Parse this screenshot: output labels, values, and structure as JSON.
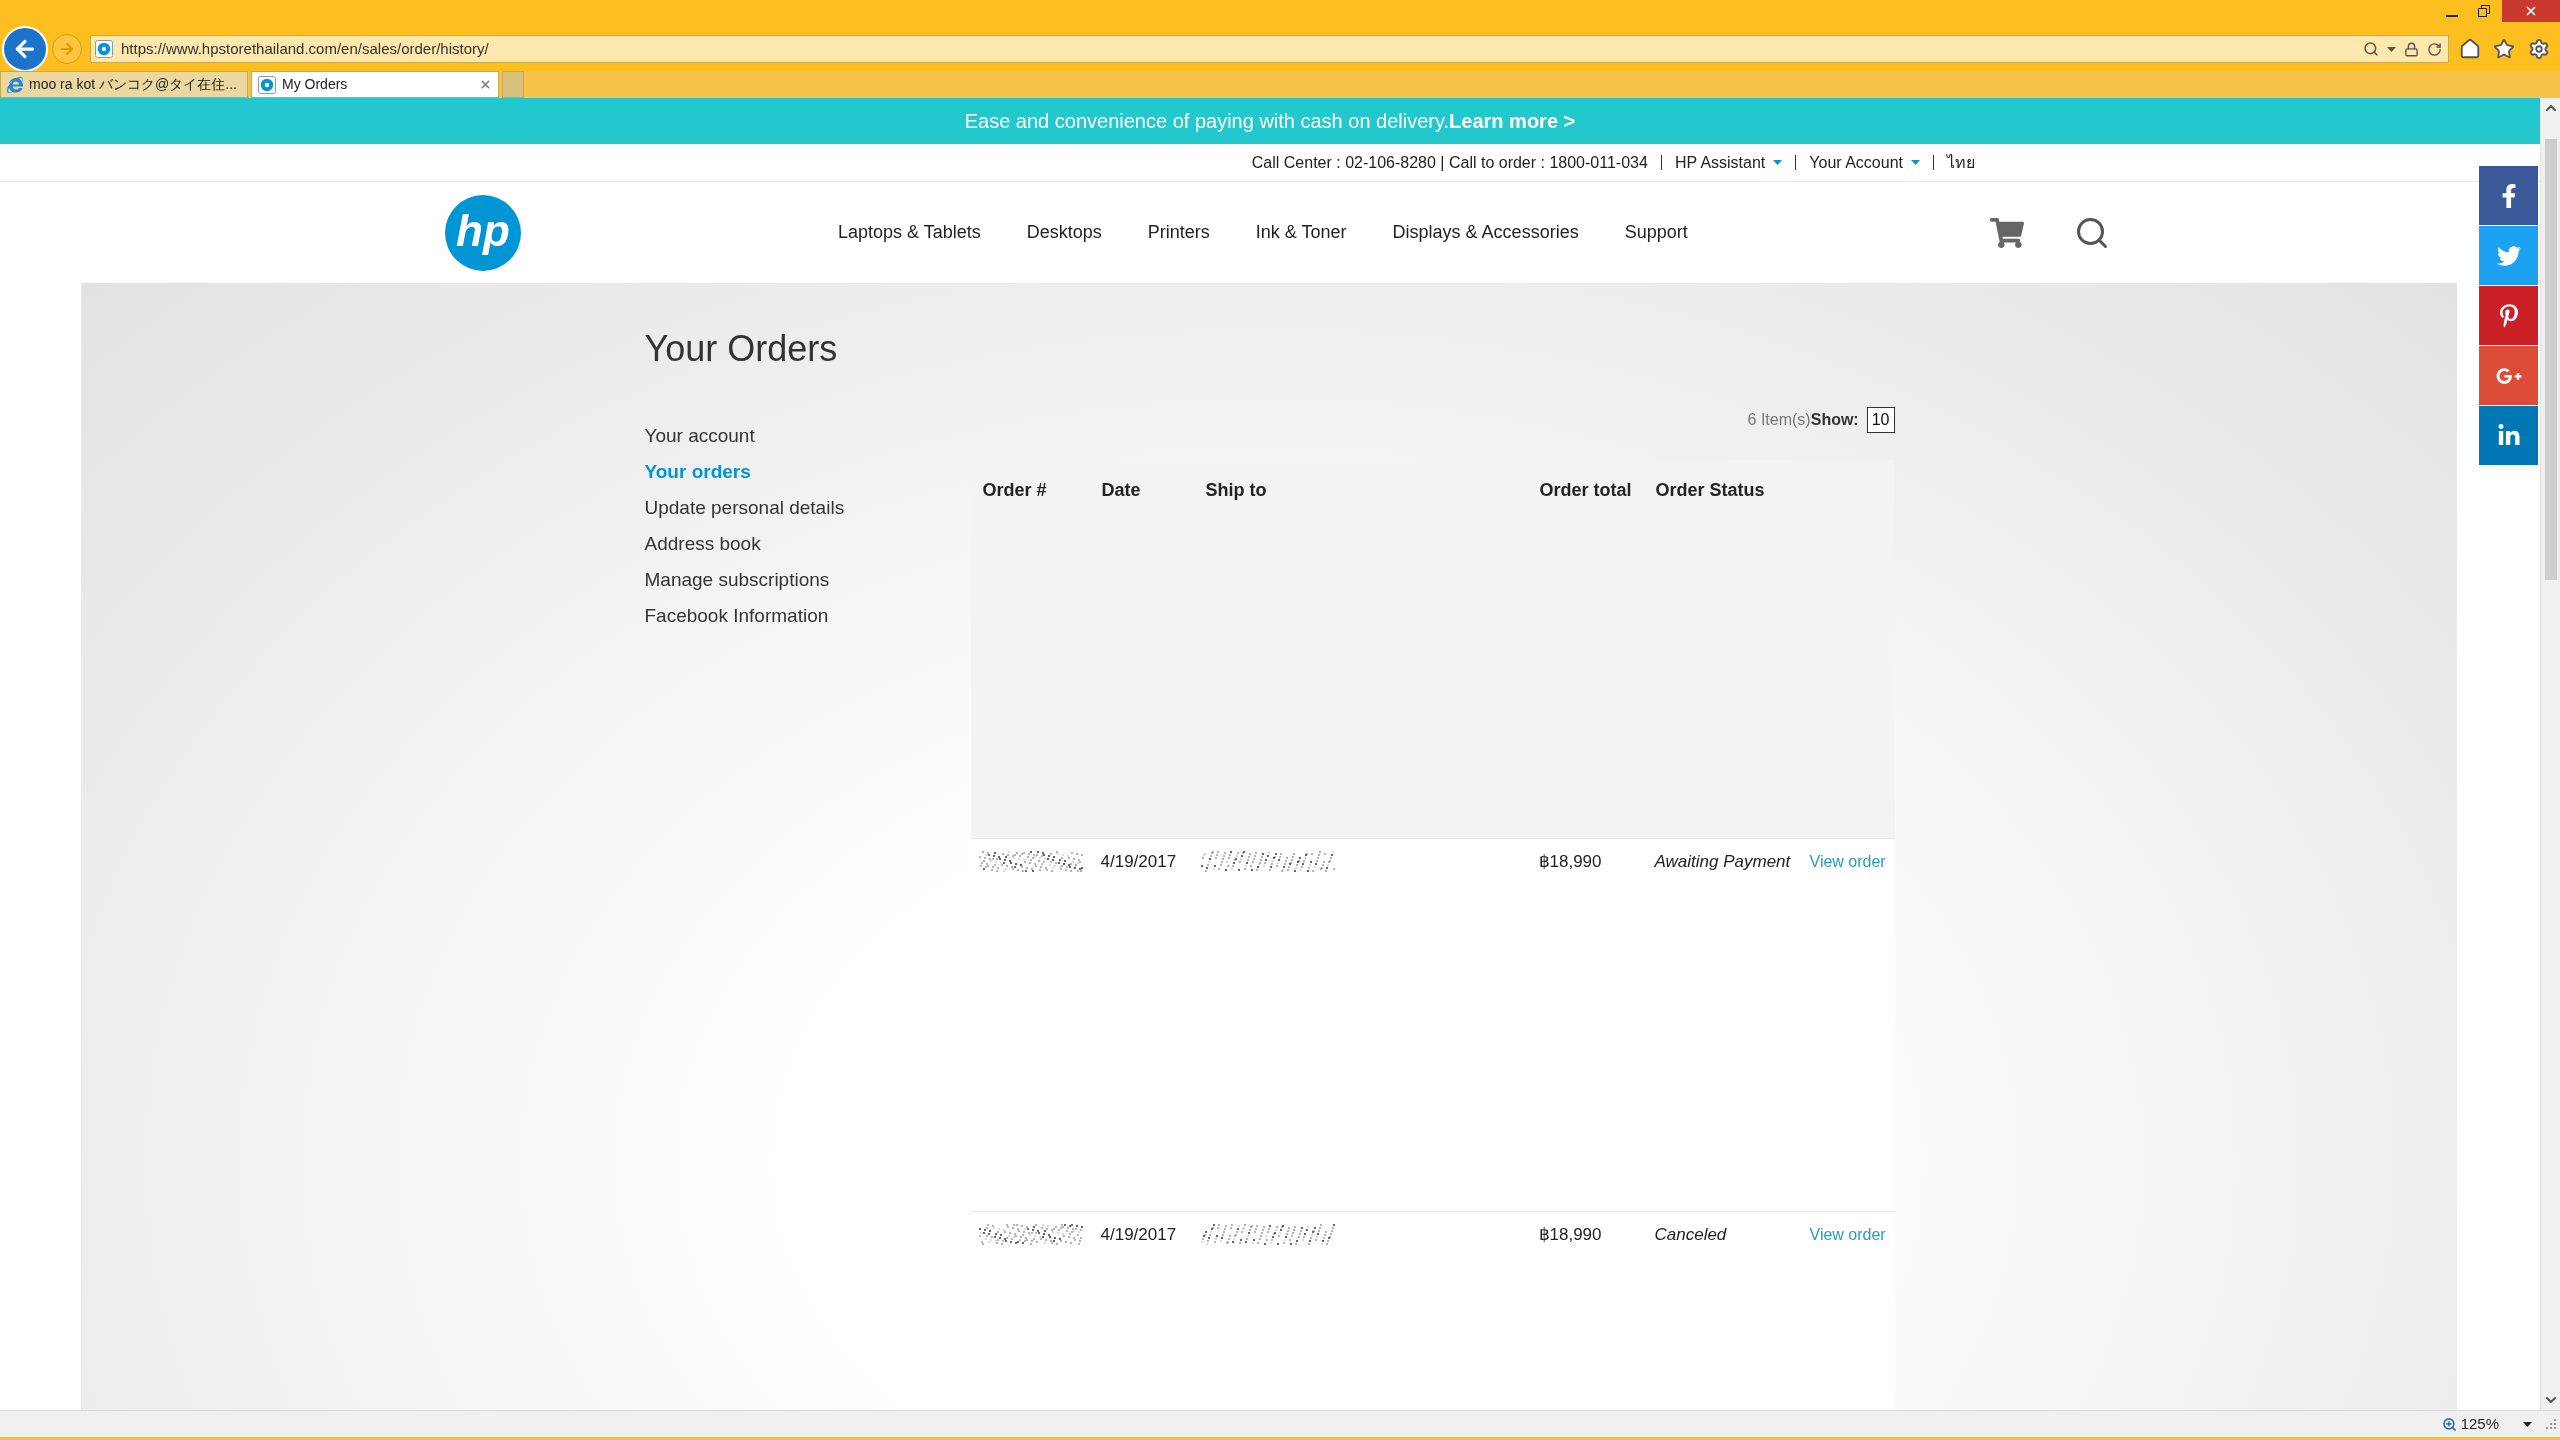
{
  "browser": {
    "url": "https://www.hpstorethailand.com/en/sales/order/history/",
    "tabs": [
      {
        "title": "moo ra kot バンコク@タイ在住...",
        "selected": false
      },
      {
        "title": "My Orders",
        "selected": true
      }
    ],
    "zoom": "125%"
  },
  "promo_banner": {
    "text": "Ease and convenience of paying with cash on delivery.",
    "link": "Learn more >"
  },
  "utility_bar": {
    "items": [
      {
        "kind": "text",
        "label": "Call Center : 02-106-8280 | Call to order : 1800-011-034"
      },
      {
        "kind": "dropdown",
        "label": "HP Assistant"
      },
      {
        "kind": "dropdown",
        "label": "Your Account"
      },
      {
        "kind": "link",
        "label": "ไทย"
      }
    ]
  },
  "header": {
    "logo": "hp",
    "nav": [
      "Laptops & Tablets",
      "Desktops",
      "Printers",
      "Ink & Toner",
      "Displays & Accessories",
      "Support"
    ]
  },
  "page": {
    "title": "Your Orders",
    "sidebar": [
      {
        "label": "Your account",
        "selected": false
      },
      {
        "label": "Your orders",
        "selected": true
      },
      {
        "label": "Update personal details",
        "selected": false
      },
      {
        "label": "Address book",
        "selected": false
      },
      {
        "label": "Manage subscriptions",
        "selected": false
      },
      {
        "label": "Facebook Information",
        "selected": false
      }
    ],
    "item_count": "6 Item(s)",
    "show_label": "Show:",
    "page_size": "10"
  },
  "table": {
    "columns": [
      "Order #",
      "Date",
      "Ship to",
      "Order total",
      "Order Status"
    ],
    "rows": [
      {
        "date": "4/19/2017",
        "total": "฿18,990",
        "status": "Awaiting Payment",
        "action": "View order"
      },
      {
        "date": "4/19/2017",
        "total": "฿18,990",
        "status": "Canceled",
        "action": "View order"
      }
    ]
  }
}
